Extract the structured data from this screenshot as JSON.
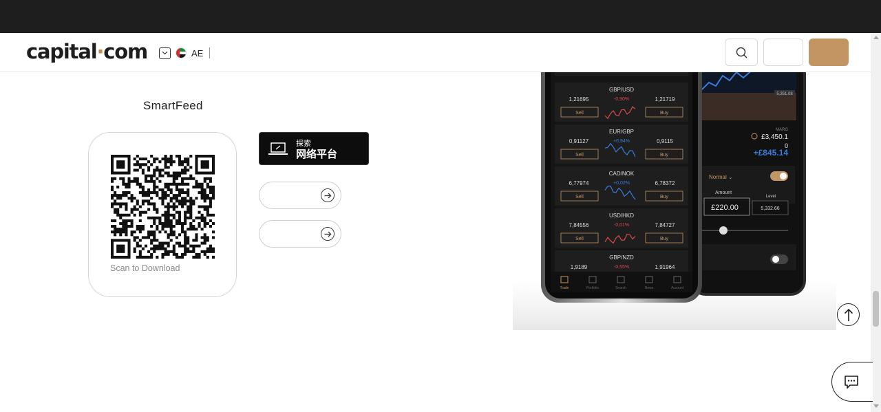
{
  "header": {
    "logo_text_a": "capital",
    "logo_dot": "·",
    "logo_text_b": "com",
    "region_code": "AE"
  },
  "smartfeed": {
    "title": "SmartFeed",
    "qr_caption": "Scan to Download",
    "explore_line1": "探索",
    "explore_line2": "网络平台"
  },
  "phone": {
    "pairs": [
      {
        "name": "GBP/USD",
        "sell": "1,21695",
        "change": "-0,90%",
        "buy": "1,21719",
        "dir": "down"
      },
      {
        "name": "EUR/GBP",
        "sell": "0,91127",
        "change": "+0,94%",
        "buy": "0,9115",
        "dir": "up"
      },
      {
        "name": "CAD/NOK",
        "sell": "6,77974",
        "change": "+0,02%",
        "buy": "6,78372",
        "dir": "up"
      },
      {
        "name": "USD/HKD",
        "sell": "7,84556",
        "change": "-0,01%",
        "buy": "7,84727",
        "dir": "down"
      },
      {
        "name": "GBP/NZD",
        "sell": "1,9189",
        "change": "-0,55%",
        "buy": "1,91964",
        "dir": "down"
      }
    ],
    "sell_label": "Sell",
    "buy_label": "Buy",
    "nav": [
      "Trade",
      "Portfolio",
      "Search",
      "News",
      "Account"
    ],
    "right": {
      "margin_label": "MARG",
      "value1": "£3,450.1",
      "value2": "0",
      "pnl": "+£845.14",
      "mode": "Normal",
      "amount_label": "Amount",
      "level_label": "Level",
      "amount": "£220.00",
      "level": "5,332.66",
      "chart_tag": "5,351.08"
    }
  },
  "colors": {
    "brand_accent": "#c39563",
    "up": "#3b7bdc",
    "down": "#d84a4a"
  }
}
